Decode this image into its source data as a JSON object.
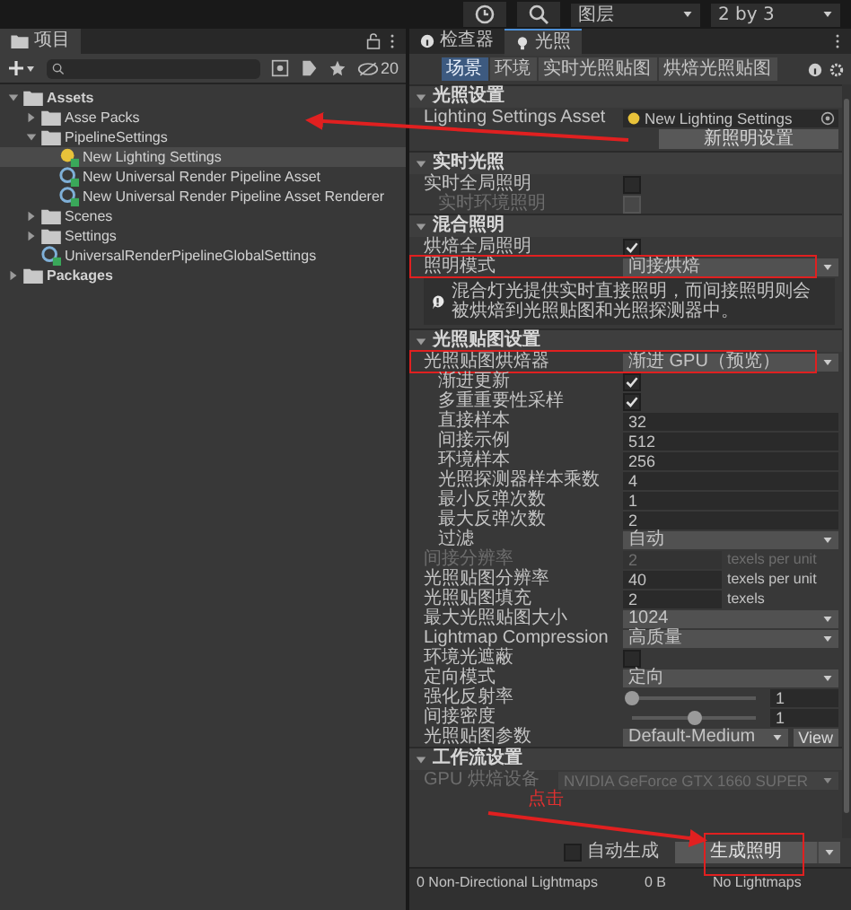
{
  "toolbar": {
    "layers": "图层",
    "layout": "2 by 3"
  },
  "project": {
    "tab": "项目",
    "hidden_count": "20",
    "tree": [
      {
        "label": "Assets",
        "kind": "folder",
        "bold": true,
        "expanded": true,
        "selected": false,
        "children": [
          {
            "label": "Asse Packs",
            "kind": "folder",
            "expanded": false,
            "selected": false
          },
          {
            "label": "PipelineSettings",
            "kind": "folder",
            "expanded": true,
            "selected": false,
            "children": [
              {
                "label": "New Lighting Settings",
                "kind": "lighting",
                "selected": true
              },
              {
                "label": "New Universal Render Pipeline Asset",
                "kind": "pipeline",
                "selected": false
              },
              {
                "label": "New Universal Render Pipeline Asset Renderer",
                "kind": "pipeline",
                "selected": false
              }
            ]
          },
          {
            "label": "Scenes",
            "kind": "folder",
            "expanded": false,
            "selected": false
          },
          {
            "label": "Settings",
            "kind": "folder",
            "expanded": false,
            "selected": false
          },
          {
            "label": "UniversalRenderPipelineGlobalSettings",
            "kind": "pipeline",
            "selected": false
          }
        ]
      },
      {
        "label": "Packages",
        "kind": "folder",
        "bold": true,
        "expanded": false,
        "selected": false
      }
    ]
  },
  "tabs": [
    {
      "label": "检查器",
      "kind": "info",
      "selected": false
    },
    {
      "label": "光照",
      "kind": "bulb",
      "selected": true
    }
  ],
  "subtabs": [
    {
      "label": "场景",
      "selected": true
    },
    {
      "label": "环境",
      "selected": false
    },
    {
      "label": "实时光照贴图",
      "selected": false
    },
    {
      "label": "烘焙光照贴图",
      "selected": false
    }
  ],
  "sections": [
    {
      "title": "光照设置",
      "expanded": true,
      "rows": [
        {
          "kind": "object",
          "label": "Lighting Settings Asset",
          "value": "New Lighting Settings"
        },
        {
          "kind": "button",
          "label": "新照明设置"
        }
      ]
    },
    {
      "title": "实时光照",
      "expanded": true,
      "rows": [
        {
          "kind": "checkbox",
          "label": "实时全局照明",
          "checked": false,
          "disabled": false,
          "indented": false
        },
        {
          "kind": "checkbox",
          "label": "实时环境照明",
          "checked": false,
          "disabled": true,
          "indented": true
        }
      ]
    },
    {
      "title": "混合照明",
      "expanded": true,
      "rows": [
        {
          "kind": "checkbox",
          "label": "烘焙全局照明",
          "checked": true,
          "disabled": false,
          "indented": false
        },
        {
          "kind": "dropdown",
          "label": "照明模式",
          "value": "间接烘焙",
          "annotated": true,
          "indented": false
        },
        {
          "kind": "help",
          "text": "混合灯光提供实时直接照明，而间接照明则会被烘焙到光照贴图和光照探测器中。"
        }
      ]
    },
    {
      "title": "光照贴图设置",
      "expanded": true,
      "rows": [
        {
          "kind": "dropdown",
          "label": "光照贴图烘焙器",
          "value": "渐进 GPU（预览）",
          "annotated": true,
          "indented": false
        },
        {
          "kind": "checkbox",
          "label": "渐进更新",
          "checked": true,
          "disabled": false,
          "indented": true
        },
        {
          "kind": "checkbox",
          "label": "多重重要性采样",
          "checked": true,
          "disabled": false,
          "indented": true
        },
        {
          "kind": "field",
          "label": "直接样本",
          "value": "32",
          "disabled": false,
          "indented": true
        },
        {
          "kind": "field",
          "label": "间接示例",
          "value": "512",
          "disabled": false,
          "indented": true
        },
        {
          "kind": "field",
          "label": "环境样本",
          "value": "256",
          "disabled": false,
          "indented": true
        },
        {
          "kind": "field",
          "label": "光照探测器样本乘数",
          "value": "4",
          "disabled": false,
          "indented": true
        },
        {
          "kind": "field",
          "label": "最小反弹次数",
          "value": "1",
          "disabled": false,
          "indented": true
        },
        {
          "kind": "field",
          "label": "最大反弹次数",
          "value": "2",
          "disabled": false,
          "indented": true
        },
        {
          "kind": "dropdown",
          "label": "过滤",
          "value": "自动",
          "annotated": false,
          "indented": true
        },
        {
          "kind": "field",
          "label": "间接分辨率",
          "value": "2",
          "unit": "texels per unit",
          "disabled": true,
          "indented": false
        },
        {
          "kind": "field",
          "label": "光照贴图分辨率",
          "value": "40",
          "unit": "texels per unit",
          "disabled": false,
          "indented": false
        },
        {
          "kind": "field",
          "label": "光照贴图填充",
          "value": "2",
          "unit": "texels",
          "disabled": false,
          "indented": false
        },
        {
          "kind": "dropdown",
          "label": "最大光照贴图大小",
          "value": "1024",
          "annotated": false,
          "indented": false
        },
        {
          "kind": "dropdown",
          "label": "Lightmap Compression",
          "value": "高质量",
          "annotated": false,
          "indented": false
        },
        {
          "kind": "checkbox",
          "label": "环境光遮蔽",
          "checked": false,
          "disabled": false,
          "indented": false
        },
        {
          "kind": "dropdown",
          "label": "定向模式",
          "value": "定向",
          "annotated": false,
          "indented": false
        },
        {
          "kind": "slider",
          "label": "强化反射率",
          "level": 0.0,
          "value": "1"
        },
        {
          "kind": "slider",
          "label": "间接密度",
          "level": 0.5,
          "value": "1"
        },
        {
          "kind": "dropdown",
          "label": "光照贴图参数",
          "value": "Default-Medium",
          "button": "View",
          "annotated": false,
          "indented": false
        }
      ]
    },
    {
      "title": "工作流设置",
      "expanded": true,
      "rows": [
        {
          "kind": "gpu",
          "label": "GPU 烘焙设备",
          "value": "NVIDIA GeForce GTX 1660 SUPER",
          "disabled": true
        },
        {
          "kind": "note",
          "text": "点击"
        }
      ]
    }
  ],
  "bake": {
    "auto_label": "自动生成",
    "auto_checked": false,
    "button": "生成照明",
    "annotated": true
  },
  "footer": {
    "lightmaps": "0 Non-Directional Lightmaps",
    "size": "0 B",
    "status": "No Lightmaps"
  }
}
